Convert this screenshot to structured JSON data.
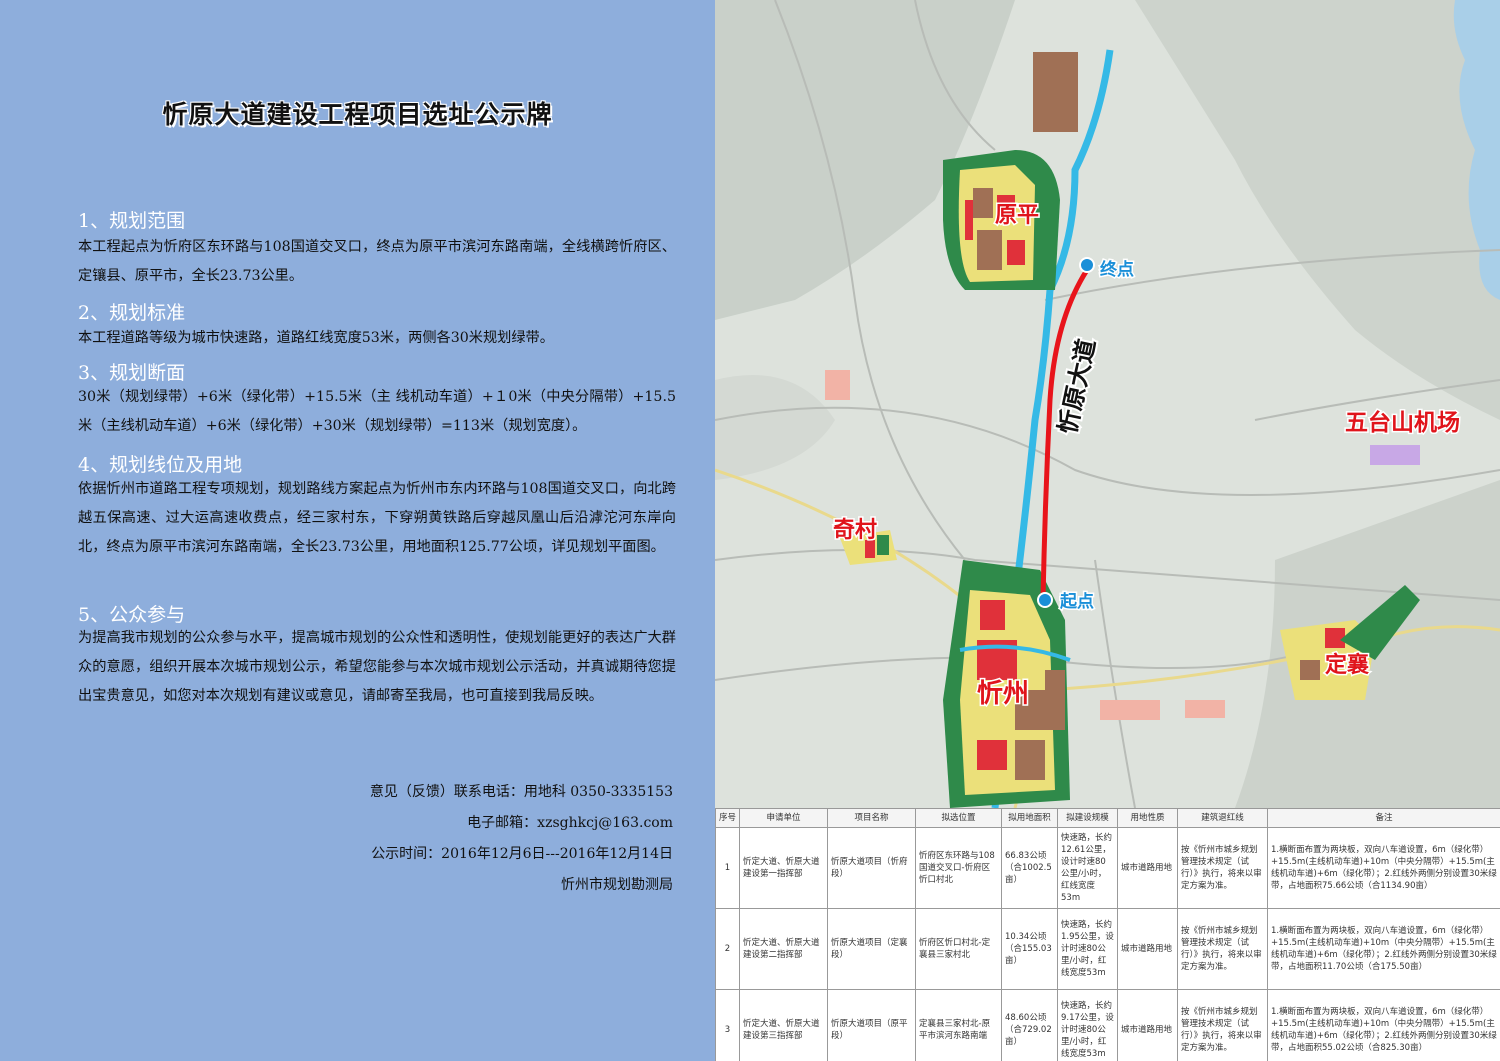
{
  "title": "忻原大道建设工程项目选址公示牌",
  "sections": [
    {
      "heading": "1、规划范围",
      "body": "本工程起点为忻府区东环路与108国道交叉口，终点为原平市滨河东路南端，全线横跨忻府区、定镶县、原平市，全长23.73公里。"
    },
    {
      "heading": "2、规划标准",
      "body": "本工程道路等级为城市快速路，道路红线宽度53米，两侧各30米规划绿带。"
    },
    {
      "heading": "3、规划断面",
      "body": " 30米（规划绿带）+6米（绿化带）+15.5米（主 线机动车道）+１0米（中央分隔带）+15.5米（主线机动车道）+6米（绿化带）+30米（规划绿带）=113米（规划宽度）。"
    },
    {
      "heading": "4、规划线位及用地",
      "body": "依据忻州市道路工程专项规划，规划路线方案起点为忻州市东内环路与108国道交叉口，向北跨越五保高速、过大运高速收费点，经三家村东，下穿朔黄铁路后穿越凤凰山后沿滹沱河东岸向北，终点为原平市滨河东路南端，全长23.73公里，用地面积125.77公顷，详见规划平面图。"
    },
    {
      "heading": "5、公众参与",
      "body": "为提高我市规划的公众参与水平，提高城市规划的公众性和透明性，使规划能更好的表达广大群众的意愿，组织开展本次城市规划公示，希望您能参与本次城市规划公示活动，并真诚期待您提出宝贵意见，如您对本次规划有建议或意见，请邮寄至我局，也可直接到我局反映。"
    }
  ],
  "footer": {
    "phone": "意见（反馈）联系电话：用地科 0350-3335153",
    "email": "电子邮箱：xzsghkcj@163.com",
    "time": "公示时间：2016年12月6日---2016年12月14日",
    "org": "忻州市规划勘测局"
  },
  "map": {
    "labels": {
      "yuanping": "原平",
      "zhongdian": "终点",
      "road": "忻原大道",
      "airport": "五台山机场",
      "qicun": "奇村",
      "qidian": "起点",
      "xinzhou": "忻州",
      "dingxiang": "定襄"
    },
    "colors": {
      "road": "#e8141b",
      "point": "#1a8fd8",
      "label": "#e0141b",
      "river": "#35b9e6",
      "green": "#2f8a4a"
    }
  },
  "table": {
    "headers": [
      "序号",
      "申请单位",
      "项目名称",
      "拟选位置",
      "拟用地面积",
      "拟建设规模",
      "用地性质",
      "建筑退红线",
      "备注"
    ],
    "rows": [
      [
        "1",
        "忻定大道、忻原大道建设第一指挥部",
        "忻原大道项目（忻府段）",
        "忻府区东环路与108国道交叉口-忻府区忻口村北",
        "66.83公顷（合1002.5亩）",
        "快速路，长约12.61公里，设计时速80公里/小时，红线宽度53m",
        "城市道路用地",
        "按《忻州市城乡规划管理技术规定（试行）》执行，将来以审定方案为准。",
        "1.横断面布置为两块板，双向八车道设置，6m（绿化带）+15.5m(主线机动车道)+10m（中央分隔带）+15.5m(主线机动车道)+6m（绿化带）；2.红线外两侧分别设置30米绿带，占地面积75.66公顷（合1134.90亩）"
      ],
      [
        "2",
        "忻定大道、忻原大道建设第二指挥部",
        "忻原大道项目（定襄段）",
        "忻府区忻口村北-定襄县三家村北",
        "10.34公顷（合155.03亩）",
        "快速路，长约1.95公里，设计时速80公里/小时，红线宽度53m",
        "城市道路用地",
        "按《忻州市城乡规划管理技术规定（试行）》执行，将来以审定方案为准。",
        "1.横断面布置为两块板，双向八车道设置，6m（绿化带）+15.5m(主线机动车道)+10m（中央分隔带）+15.5m(主线机动车道)+6m（绿化带）；2.红线外两侧分别设置30米绿带，占地面积11.70公顷（合175.50亩）"
      ],
      [
        "3",
        "忻定大道、忻原大道建设第三指挥部",
        "忻原大道项目（原平段）",
        "定襄县三家村北-原平市滨河东路南端",
        "48.60公顷（合729.02亩）",
        "快速路，长约9.17公里，设计时速80公里/小时，红线宽度53m",
        "城市道路用地",
        "按《忻州市城乡规划管理技术规定（试行）》执行，将来以审定方案为准。",
        "1.横断面布置为两块板，双向八车道设置，6m（绿化带）+15.5m(主线机动车道)+10m（中央分隔带）+15.5m(主线机动车道)+6m（绿化带）；2.红线外两侧分别设置30米绿带，占地面积55.02公顷（合825.30亩）"
      ]
    ]
  }
}
